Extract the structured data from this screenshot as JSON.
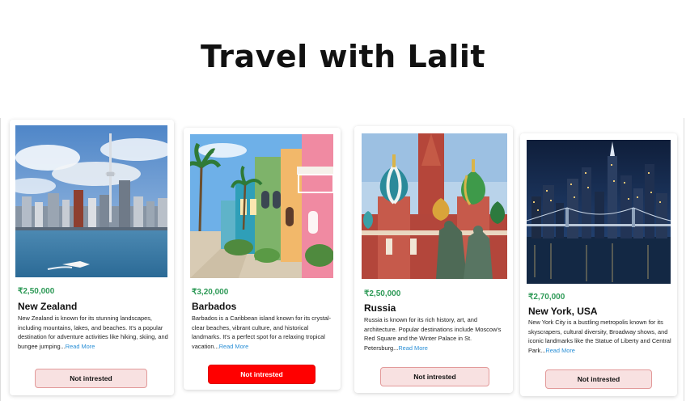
{
  "page": {
    "title": "Travel with Lalit"
  },
  "colors": {
    "price": "#2e9a57",
    "read_more": "#2a8fd6",
    "button_default_bg": "#f8e1e1",
    "button_default_border": "#e29a9a",
    "button_active_bg": "#ff0000"
  },
  "cards": [
    {
      "image_alt": "Auckland skyline with Sky Tower and harbor",
      "price": "₹2,50,000",
      "name": "New Zealand",
      "description": "New Zealand is known for its stunning landscapes, including mountains, lakes, and beaches. It's a popular destination for adventure activities like hiking, skiing, and bungee jumping...",
      "read_more": "Read More",
      "button_label": "Not intrested",
      "button_state": "default"
    },
    {
      "image_alt": "Colorful Caribbean houses with palm trees",
      "price": "₹3,20,000",
      "name": "Barbados",
      "description": "Barbados is a Caribbean island known for its crystal-clear beaches, vibrant culture, and historical landmarks. It's a perfect spot for a relaxing tropical vacation...",
      "read_more": "Read More",
      "button_label": "Not intrested",
      "button_state": "active"
    },
    {
      "image_alt": "Saint Basil's Cathedral onion domes",
      "price": "₹2,50,000",
      "name": "Russia",
      "description": "Russia is known for its rich history, art, and architecture. Popular destinations include Moscow's Red Square and the Winter Palace in St. Petersburg...",
      "read_more": "Read More",
      "button_label": "Not intrested",
      "button_state": "default"
    },
    {
      "image_alt": "New York City skyline at night with bridge",
      "price": "₹2,70,000",
      "name": "New York, USA",
      "description": "New York City is a bustling metropolis known for its skyscrapers, cultural diversity, Broadway shows, and iconic landmarks like the Statue of Liberty and Central Park...",
      "read_more": "Read More",
      "button_label": "Not intrested",
      "button_state": "default"
    }
  ]
}
